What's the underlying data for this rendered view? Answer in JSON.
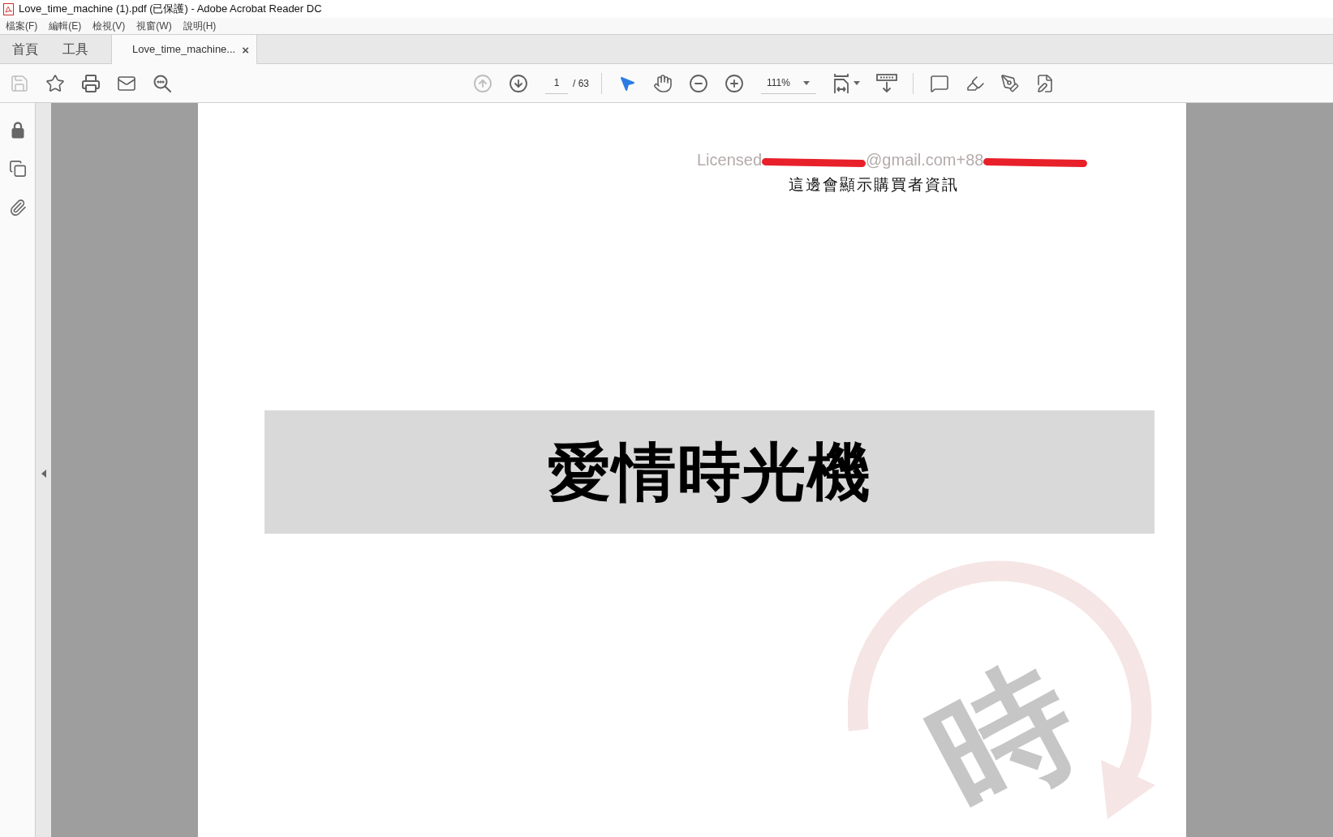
{
  "window": {
    "title": "Love_time_machine (1).pdf (已保護) - Adobe Acrobat Reader DC"
  },
  "menu": [
    "檔案(F)",
    "編輯(E)",
    "檢視(V)",
    "視窗(W)",
    "說明(H)"
  ],
  "tabs": [
    {
      "kind": "nav",
      "label": "首頁",
      "selected": false
    },
    {
      "kind": "nav",
      "label": "工具",
      "selected": false
    },
    {
      "kind": "document",
      "label": "Love_time_machine...",
      "close": "×",
      "selected": true
    }
  ],
  "toolbar": {
    "save": {
      "disabled": true
    },
    "previous_page": {
      "disabled": true
    },
    "next_page": {
      "disabled": false
    },
    "page_number": "1",
    "page_total": "/ 63",
    "select_tool": {
      "selected": true
    },
    "hand_tool": {
      "selected": false
    },
    "zoom_value": "111%"
  },
  "document": {
    "license_line": [
      {
        "kind": "text",
        "text": "Licensed"
      },
      {
        "kind": "redaction"
      },
      {
        "kind": "text",
        "text": "@gmail.com+88"
      },
      {
        "kind": "redaction"
      }
    ],
    "license_note": "這邊會顯示購買者資訊",
    "title": "愛情時光機",
    "watermark": "時"
  }
}
